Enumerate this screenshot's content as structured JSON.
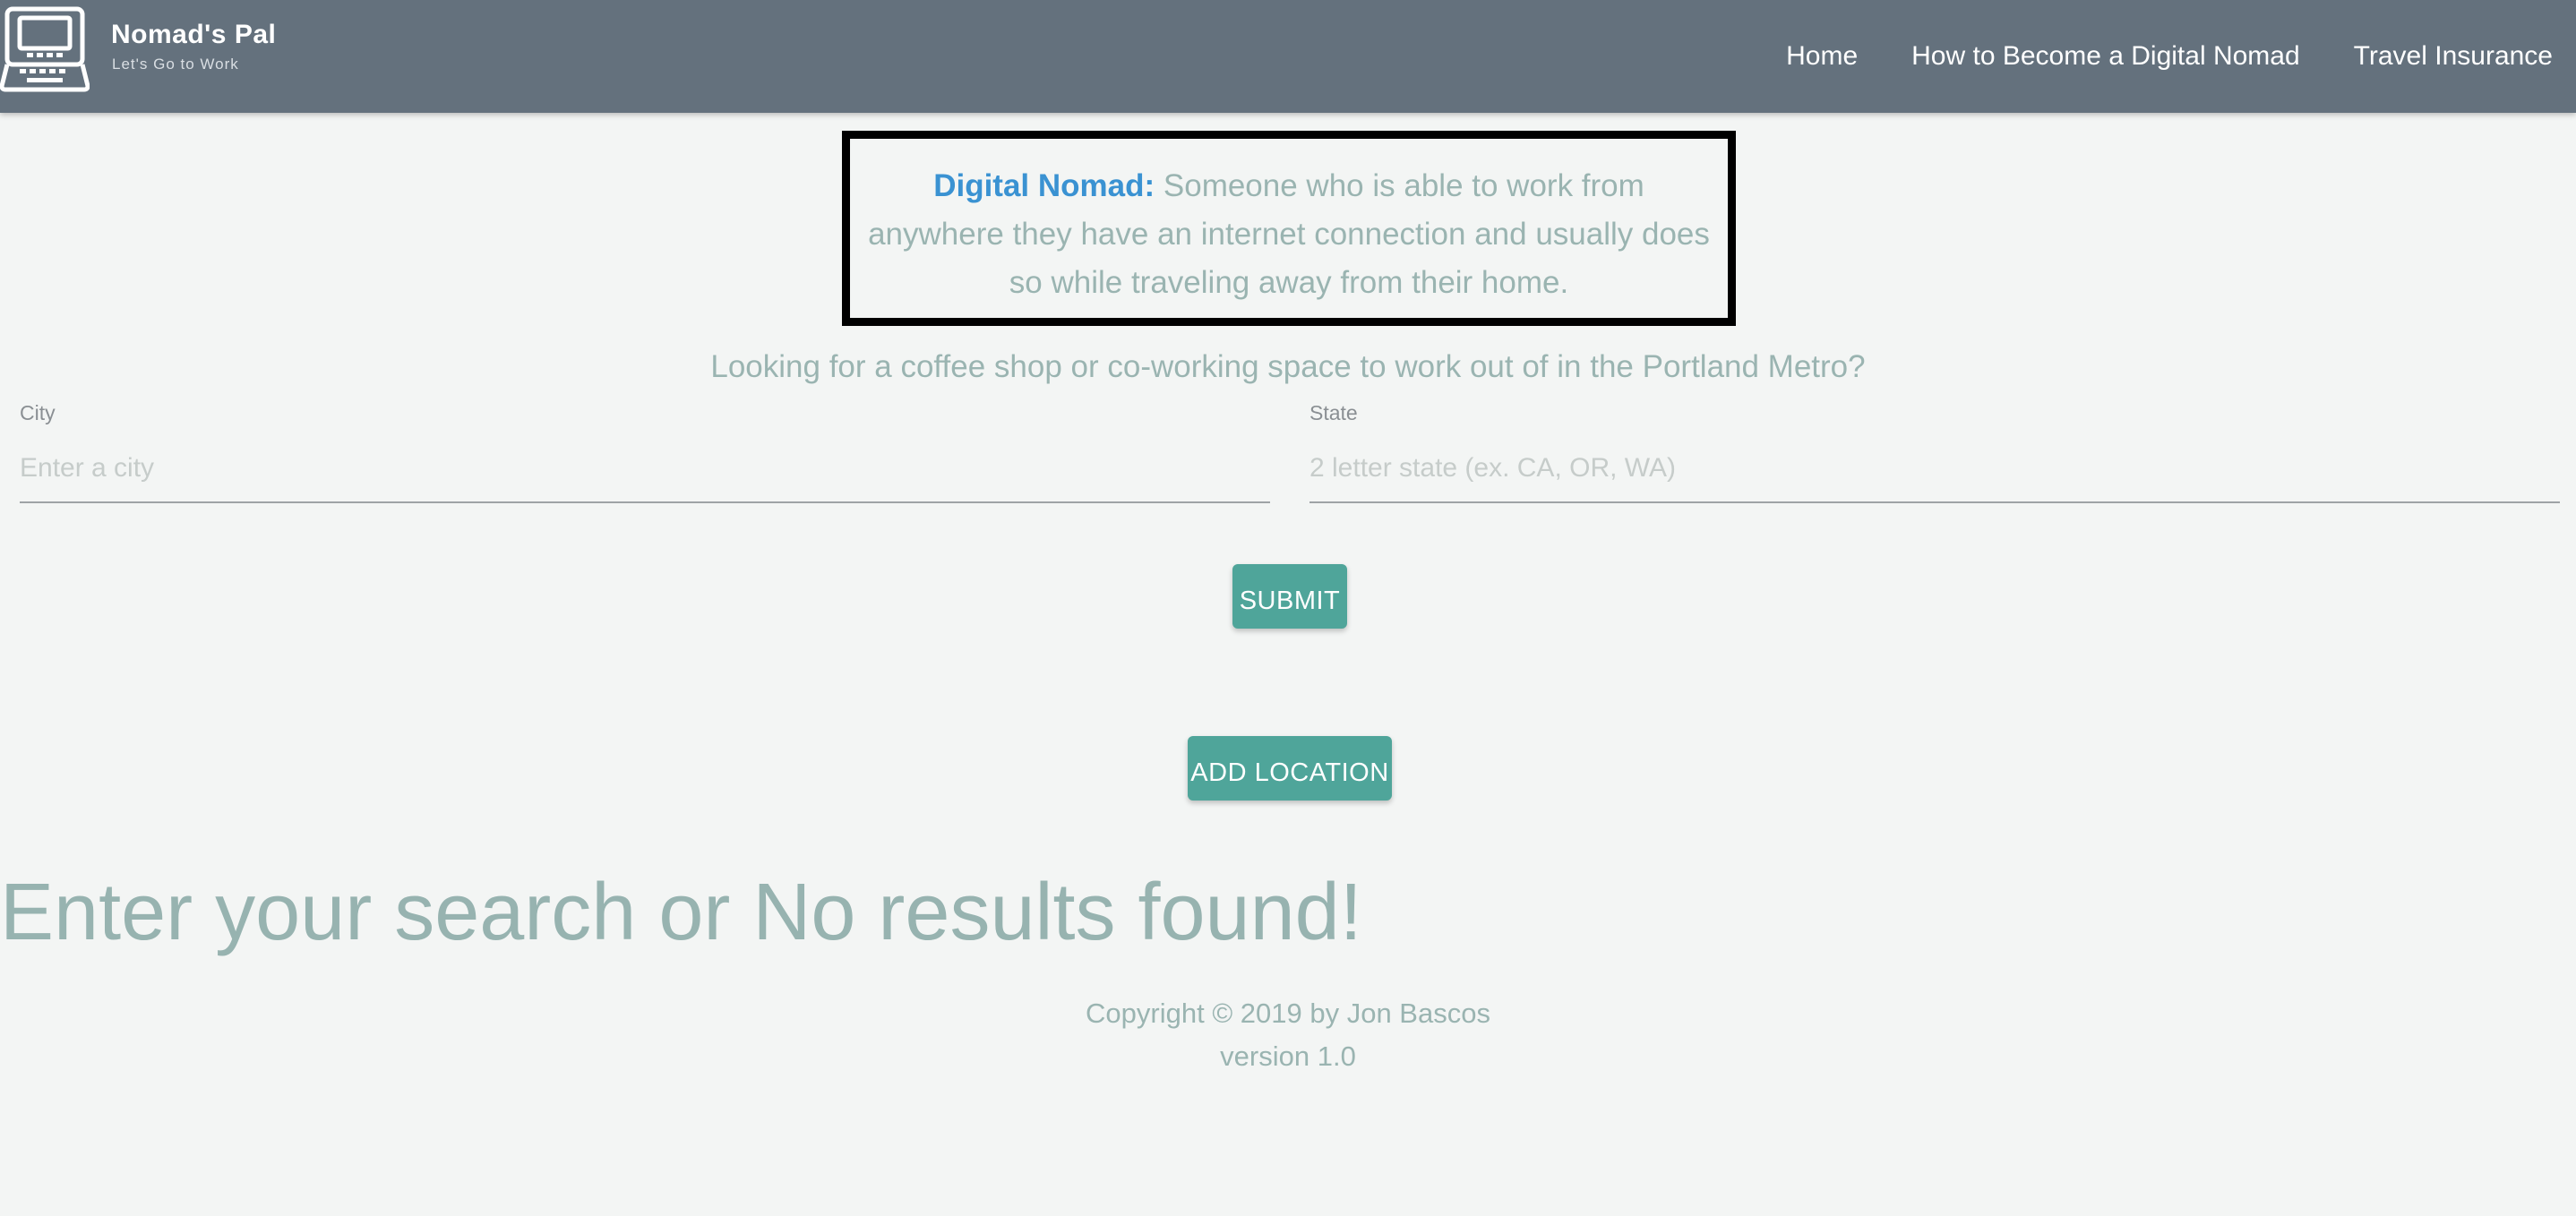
{
  "navbar": {
    "brand_name": "Nomad's Pal",
    "brand_tagline": "Let's Go to Work",
    "logo_icon": "laptop-icon",
    "links": [
      {
        "label": "Home"
      },
      {
        "label": "How to Become a Digital Nomad"
      },
      {
        "label": "Travel Insurance"
      }
    ],
    "background_color": "#64717d"
  },
  "definition": {
    "term": "Digital Nomad:",
    "text": " Someone who is able to work from anywhere they have an internet connection and usually does so while traveling away from their home."
  },
  "search": {
    "intro": "Looking for a coffee shop or co-working space to work out of in the Portland Metro?",
    "city": {
      "label": "City",
      "value": "",
      "placeholder": "Enter a city"
    },
    "state": {
      "label": "State",
      "value": "",
      "placeholder": "2 letter state (ex. CA, OR, WA)"
    },
    "submit_label": "SUBMIT",
    "add_location_label": "ADD LOCATION"
  },
  "results": {
    "message": "Enter your search or No results found!"
  },
  "footer": {
    "copyright": "Copyright © 2019 by Jon Bascos",
    "version": "version 1.0"
  },
  "colors": {
    "accent": "#4fa59a",
    "term": "#3a92d2",
    "muted_text": "#9ab4b1"
  }
}
